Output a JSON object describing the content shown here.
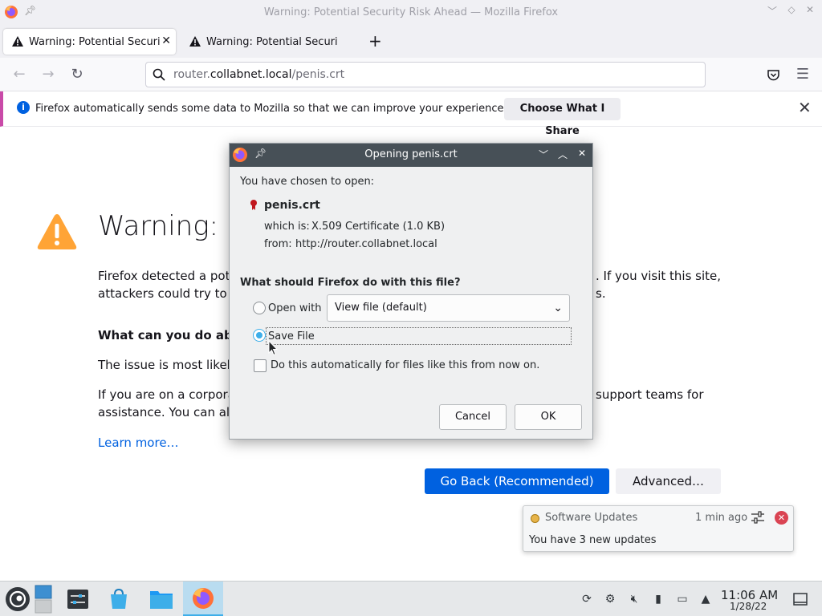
{
  "window": {
    "title": "Warning: Potential Security Risk Ahead — Mozilla Firefox"
  },
  "tabs": [
    {
      "label": "Warning: Potential Security Risk Ahead",
      "active": true
    },
    {
      "label": "Warning: Potential Security Risk Ahead",
      "active": false
    }
  ],
  "navbar": {
    "url_pre": "router.",
    "url_host": "collabnet.local",
    "url_post": "/penis.crt"
  },
  "notification": {
    "message": "Firefox automatically sends some data to Mozilla so that we can improve your experience.",
    "button": "Choose What I Share"
  },
  "page": {
    "title": "Warning: Po",
    "para1_left": "Firefox detected a pote",
    "para1_right": ". If you visit this site,",
    "para2_left": "attackers could try to st",
    "para2_right": "s.",
    "heading": "What can you do abou",
    "issue_line": "The issue is most likely",
    "corp_left": "If you are on a corporat",
    "corp_right": "support teams for",
    "assist_left": "assistance. You can also",
    "learn_more": "Learn more…",
    "go_back": "Go Back (Recommended)",
    "advanced": "Advanced…"
  },
  "dialog": {
    "title": "Opening penis.crt",
    "chosen": "You have chosen to open:",
    "filename": "penis.crt",
    "which_is_label": "which is:",
    "which_is_value": "X.509 Certificate (1.0 KB)",
    "from_label": "from:",
    "from_value": "http://router.collabnet.local",
    "question": "What should Firefox do with this file?",
    "open_with_label": "Open with",
    "open_with_value": "View file (default)",
    "save_file_label": "Save File",
    "auto_label": "Do this automatically for files like this from now on.",
    "cancel": "Cancel",
    "ok": "OK",
    "selected_option": "save_file"
  },
  "popup": {
    "app": "Software Updates",
    "time": "1 min ago",
    "body": "You have 3 new updates"
  },
  "taskbar": {
    "time": "11:06 AM",
    "date": "1/28/22"
  },
  "colors": {
    "primary_blue": "#0061e0",
    "kde_highlight": "#3daee9",
    "dialog_titlebar": "#475057"
  }
}
